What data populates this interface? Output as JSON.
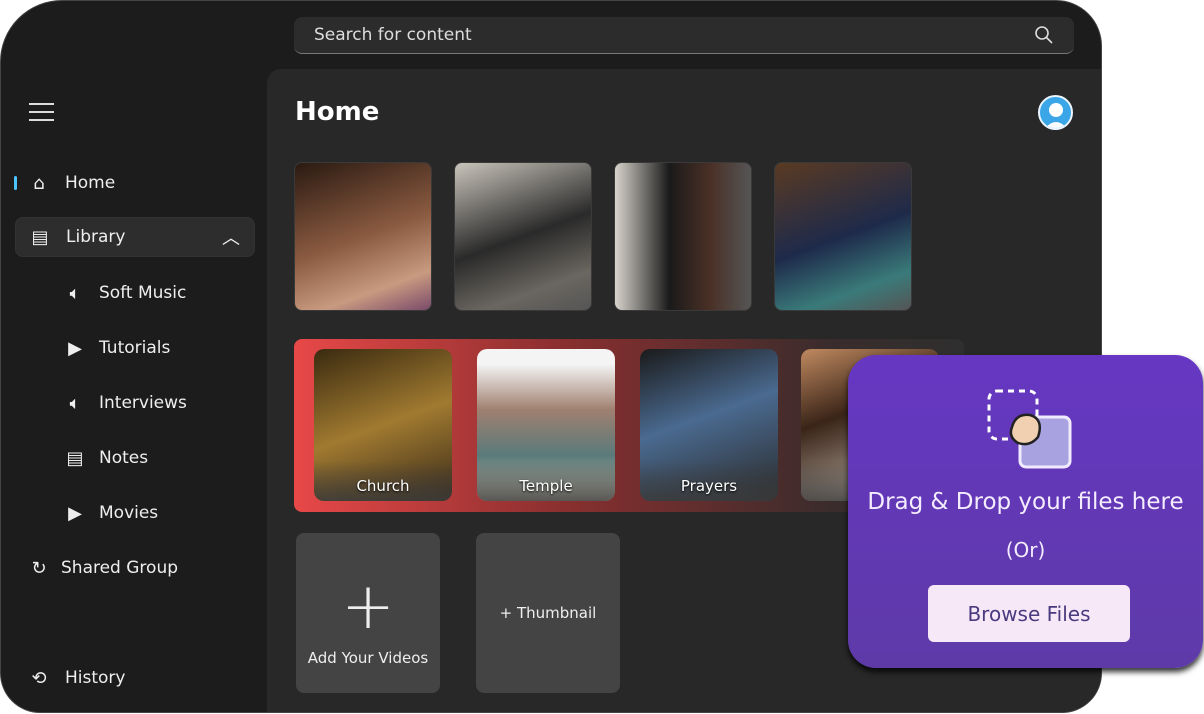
{
  "search": {
    "placeholder": "Search for content",
    "icon": "search-icon"
  },
  "sidebar": {
    "items": [
      {
        "label": "Home",
        "icon": "home-icon"
      },
      {
        "label": "Library",
        "icon": "library-icon"
      },
      {
        "label": "Soft Music",
        "icon": "speaker-icon"
      },
      {
        "label": "Tutorials",
        "icon": "play-icon"
      },
      {
        "label": "Interviews",
        "icon": "speaker-icon"
      },
      {
        "label": "Notes",
        "icon": "notes-icon"
      },
      {
        "label": "Movies",
        "icon": "play-icon"
      },
      {
        "label": "Shared Group",
        "icon": "sync-icon"
      },
      {
        "label": "History",
        "icon": "history-icon"
      }
    ]
  },
  "main": {
    "title": "Home",
    "featured": [
      "Church",
      "Temple",
      "Prayers"
    ],
    "add_videos": "Add Your Videos",
    "thumbnail": "+ Thumbnail"
  },
  "upload": {
    "title": "Drag & Drop your files here",
    "or": "(Or)",
    "browse": "Browse Files"
  },
  "colors": {
    "accent": "#4cc2ff",
    "popup": "#6637c2",
    "strip": "#e84848"
  }
}
